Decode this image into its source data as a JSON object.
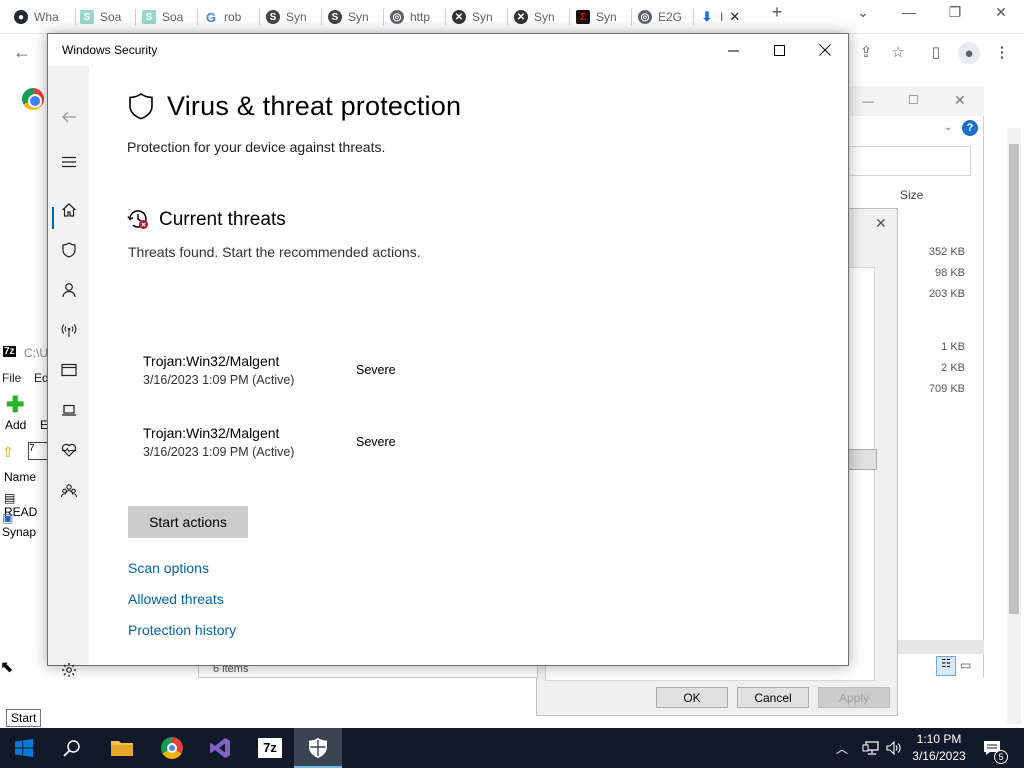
{
  "browser": {
    "tabs": [
      {
        "label": "Wha",
        "icon": "github-icon"
      },
      {
        "label": "Soa",
        "icon": "soap-icon"
      },
      {
        "label": "Soa",
        "icon": "soap-icon"
      },
      {
        "label": "rob",
        "icon": "google-icon"
      },
      {
        "label": "Syn",
        "icon": "synapse-icon"
      },
      {
        "label": "Syn",
        "icon": "synapse-icon"
      },
      {
        "label": "http",
        "icon": "globe-icon"
      },
      {
        "label": "Syn",
        "icon": "synapse-x-icon"
      },
      {
        "label": "Syn",
        "icon": "synapse-x-icon"
      },
      {
        "label": "Syn",
        "icon": "synapse-red-icon"
      },
      {
        "label": "E2G",
        "icon": "globe-icon"
      },
      {
        "label": "I",
        "icon": "download-icon"
      }
    ]
  },
  "explorer": {
    "size_header": "Size",
    "sizes": [
      "352 KB",
      "98 KB",
      "203 KB",
      "1 KB",
      "2 KB",
      "709 KB"
    ],
    "items_count": "6 items",
    "ellipsis_button": "ed..."
  },
  "properties_dialog": {
    "ok": "OK",
    "cancel": "Cancel",
    "apply": "Apply"
  },
  "sevenzip": {
    "path": "C:\\U",
    "menu_file": "File",
    "menu_edit": "Ed",
    "add_label": "Add",
    "extract_label": "E",
    "name_header": "Name",
    "files": [
      "READ",
      "Synap"
    ]
  },
  "start_tooltip": "Start",
  "windows_security": {
    "window_title": "Windows Security",
    "page_title": "Virus & threat protection",
    "page_subtitle": "Protection for your device against threats.",
    "current_threats_title": "Current threats",
    "current_threats_subtitle": "Threats found. Start the recommended actions.",
    "threats": [
      {
        "name": "Trojan:Win32/Malgent",
        "date": "3/16/2023 1:09 PM (Active)",
        "severity": "Severe"
      },
      {
        "name": "Trojan:Win32/Malgent",
        "date": "3/16/2023 1:09 PM (Active)",
        "severity": "Severe"
      }
    ],
    "start_actions_button": "Start actions",
    "links": [
      "Scan options",
      "Allowed threats",
      "Protection history"
    ],
    "accent_color": "#0063b1",
    "threat_badge_color": "#c50f1f"
  },
  "taskbar": {
    "time": "1:10 PM",
    "date": "3/16/2023",
    "notification_count": "5",
    "apps": [
      "windows-start",
      "search",
      "file-explorer",
      "chrome",
      "visual-studio",
      "7-zip",
      "windows-security"
    ]
  }
}
